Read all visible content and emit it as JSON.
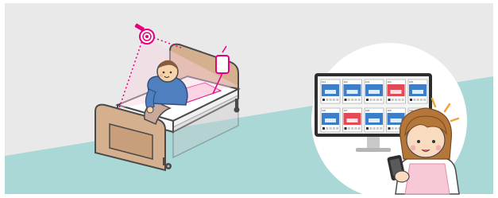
{
  "colors": {
    "background": "#e9e9ea",
    "floor": "#a9d8d6",
    "bed_frame": "#d5b08f",
    "bed_outline": "#4a4a4a",
    "mattress": "#ffffff",
    "sheet_pink": "#fbd3e2",
    "camera_magenta": "#e5007f",
    "patient_shirt": "#4f7fbf",
    "patient_skin": "#f6d2a8",
    "caregiver_hair": "#b5763a",
    "caregiver_apron": "#f7c9d6",
    "monitor_body": "#2e2e2e"
  },
  "icons": {
    "camera": "ceiling-camera-icon",
    "sensor": "bed-sensor-icon",
    "phone": "smartphone-icon"
  },
  "monitor": {
    "tiles": [
      {
        "id": "101",
        "color": "#3c7ec8"
      },
      {
        "id": "102",
        "color": "#3c7ec8"
      },
      {
        "id": "103",
        "color": "#3c7ec8"
      },
      {
        "id": "104",
        "color": "#e24a55"
      },
      {
        "id": "105",
        "color": "#3c7ec8"
      },
      {
        "id": "106",
        "color": "#3c7ec8"
      },
      {
        "id": "107",
        "color": "#e24a55"
      },
      {
        "id": "108",
        "color": "#3c7ec8"
      },
      {
        "id": "109",
        "color": "#3c7ec8"
      },
      {
        "id": "110",
        "color": "#3c7ec8"
      }
    ]
  }
}
